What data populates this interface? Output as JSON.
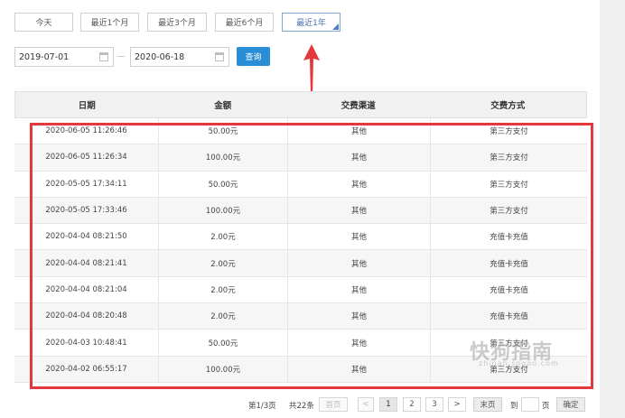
{
  "quick_ranges": [
    "今天",
    "最近1个月",
    "最近3个月",
    "最近6个月",
    "最近1年"
  ],
  "active_range": "最近1年",
  "date_from": "2019-07-01",
  "date_to": "2020-06-18",
  "query_label": "查询",
  "columns": [
    "日期",
    "金额",
    "交费渠道",
    "交费方式"
  ],
  "rows": [
    [
      "2020-06-05 11:26:46",
      "50.00元",
      "其他",
      "第三方支付"
    ],
    [
      "2020-06-05 11:26:34",
      "100.00元",
      "其他",
      "第三方支付"
    ],
    [
      "2020-05-05 17:34:11",
      "50.00元",
      "其他",
      "第三方支付"
    ],
    [
      "2020-05-05 17:33:46",
      "100.00元",
      "其他",
      "第三方支付"
    ],
    [
      "2020-04-04 08:21:50",
      "2.00元",
      "其他",
      "充值卡充值"
    ],
    [
      "2020-04-04 08:21:41",
      "2.00元",
      "其他",
      "充值卡充值"
    ],
    [
      "2020-04-04 08:21:04",
      "2.00元",
      "其他",
      "充值卡充值"
    ],
    [
      "2020-04-04 08:20:48",
      "2.00元",
      "其他",
      "充值卡充值"
    ],
    [
      "2020-04-03 10:48:41",
      "50.00元",
      "其他",
      "第三方支付"
    ],
    [
      "2020-04-02 06:55:17",
      "100.00元",
      "其他",
      "第三方支付"
    ]
  ],
  "pagination": {
    "page_info": "第1/3页",
    "total": "共22条",
    "first": "首页",
    "prev": "<",
    "pages": [
      "1",
      "2",
      "3"
    ],
    "next": ">",
    "last": "末页",
    "goto_prefix": "到",
    "goto_suffix": "页",
    "confirm": "确定"
  },
  "watermark": "快狗指南",
  "watermark_sub": "zhinan.sogou.com",
  "colors": {
    "accent": "#2a8ed6",
    "highlight": "#e3393c",
    "active_border": "#7fa6d8"
  }
}
